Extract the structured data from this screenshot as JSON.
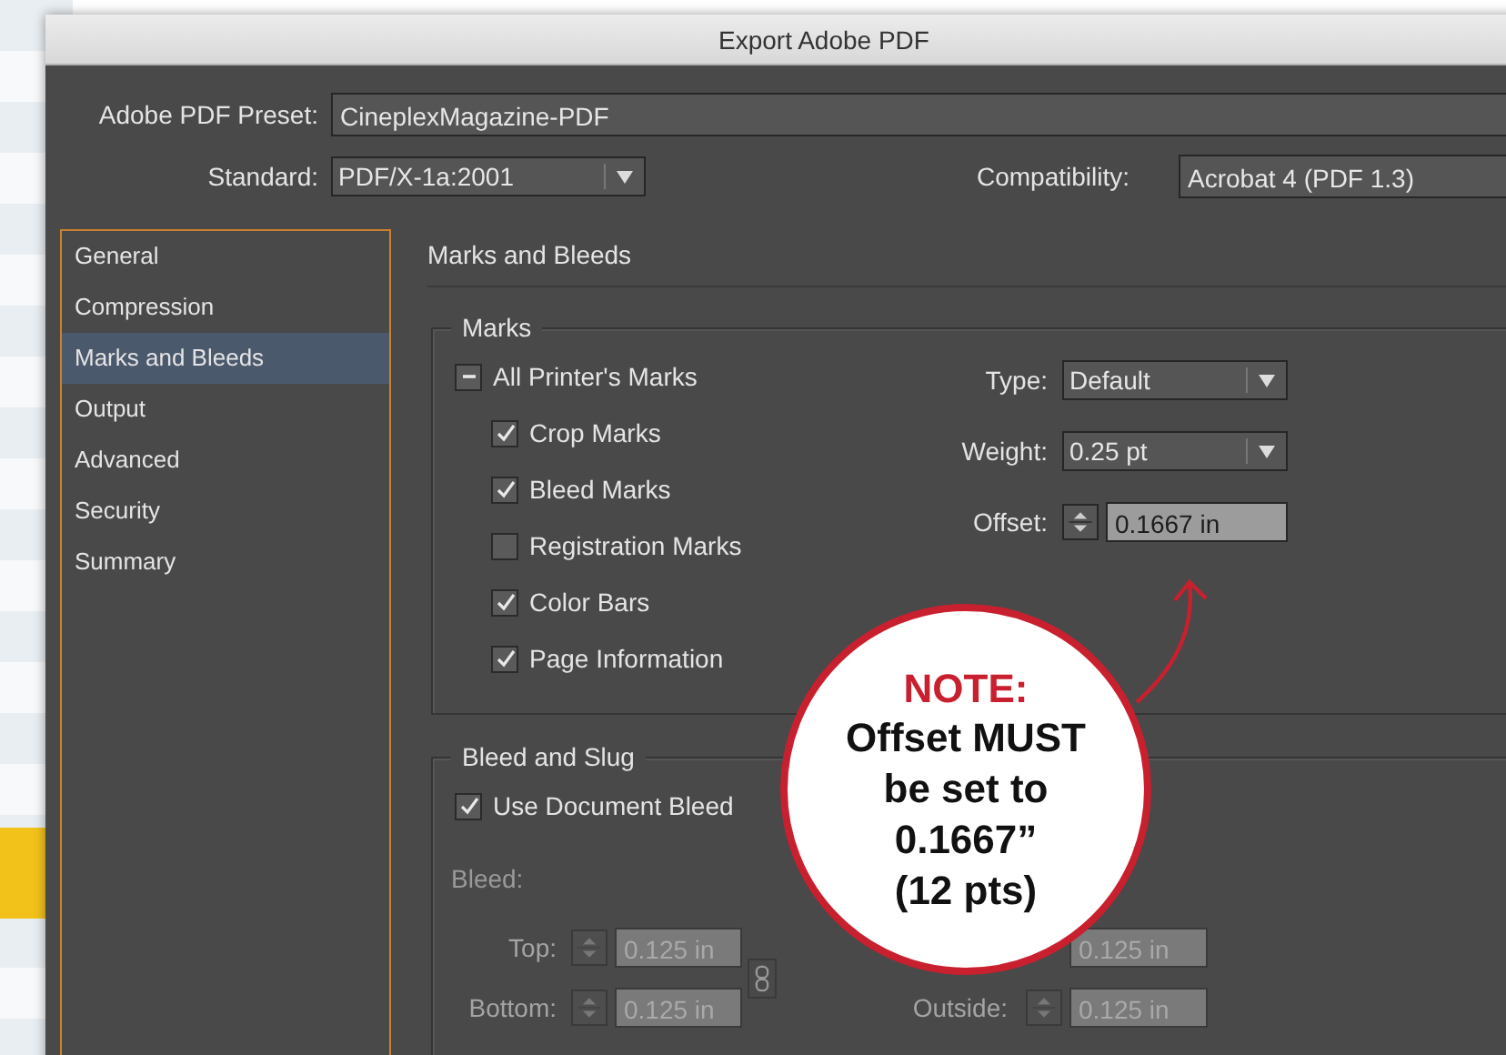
{
  "window": {
    "title": "Export Adobe PDF"
  },
  "preset": {
    "label": "Adobe PDF Preset:",
    "value": "CineplexMagazine-PDF"
  },
  "standard": {
    "label": "Standard:",
    "value": "PDF/X-1a:2001"
  },
  "compatibility": {
    "label": "Compatibility:",
    "value": "Acrobat 4 (PDF 1.3)"
  },
  "sidebar": {
    "items": [
      {
        "label": "General",
        "selected": false
      },
      {
        "label": "Compression",
        "selected": false
      },
      {
        "label": "Marks and Bleeds",
        "selected": true
      },
      {
        "label": "Output",
        "selected": false
      },
      {
        "label": "Advanced",
        "selected": false
      },
      {
        "label": "Security",
        "selected": false
      },
      {
        "label": "Summary",
        "selected": false
      }
    ]
  },
  "section_title": "Marks and Bleeds",
  "marks": {
    "legend": "Marks",
    "all_printers_marks": {
      "label": "All Printer's Marks",
      "indeterminate": true
    },
    "options": [
      {
        "label": "Crop Marks",
        "checked": true
      },
      {
        "label": "Bleed Marks",
        "checked": true
      },
      {
        "label": "Registration Marks",
        "checked": false
      },
      {
        "label": "Color Bars",
        "checked": true
      },
      {
        "label": "Page Information",
        "checked": true
      }
    ],
    "type": {
      "label": "Type:",
      "value": "Default"
    },
    "weight": {
      "label": "Weight:",
      "value": "0.25 pt"
    },
    "offset": {
      "label": "Offset:",
      "value": "0.1667 in"
    }
  },
  "bleed_and_slug": {
    "legend": "Bleed and Slug",
    "disabled": true,
    "use_document_bleed": {
      "label": "Use Document Bleed",
      "checked": true
    },
    "bleed_label": "Bleed:",
    "left_fields": [
      {
        "label": "Top:",
        "value": "0.125 in"
      },
      {
        "label": "Bottom:",
        "value": "0.125 in"
      }
    ],
    "right_fields": [
      {
        "value": "0.125 in"
      },
      {
        "label": "Outside:",
        "value": "0.125 in"
      }
    ]
  },
  "callout": {
    "title": "NOTE:",
    "text": "Offset MUST\nbe set to\n0.1667”\n(12 pts)"
  }
}
